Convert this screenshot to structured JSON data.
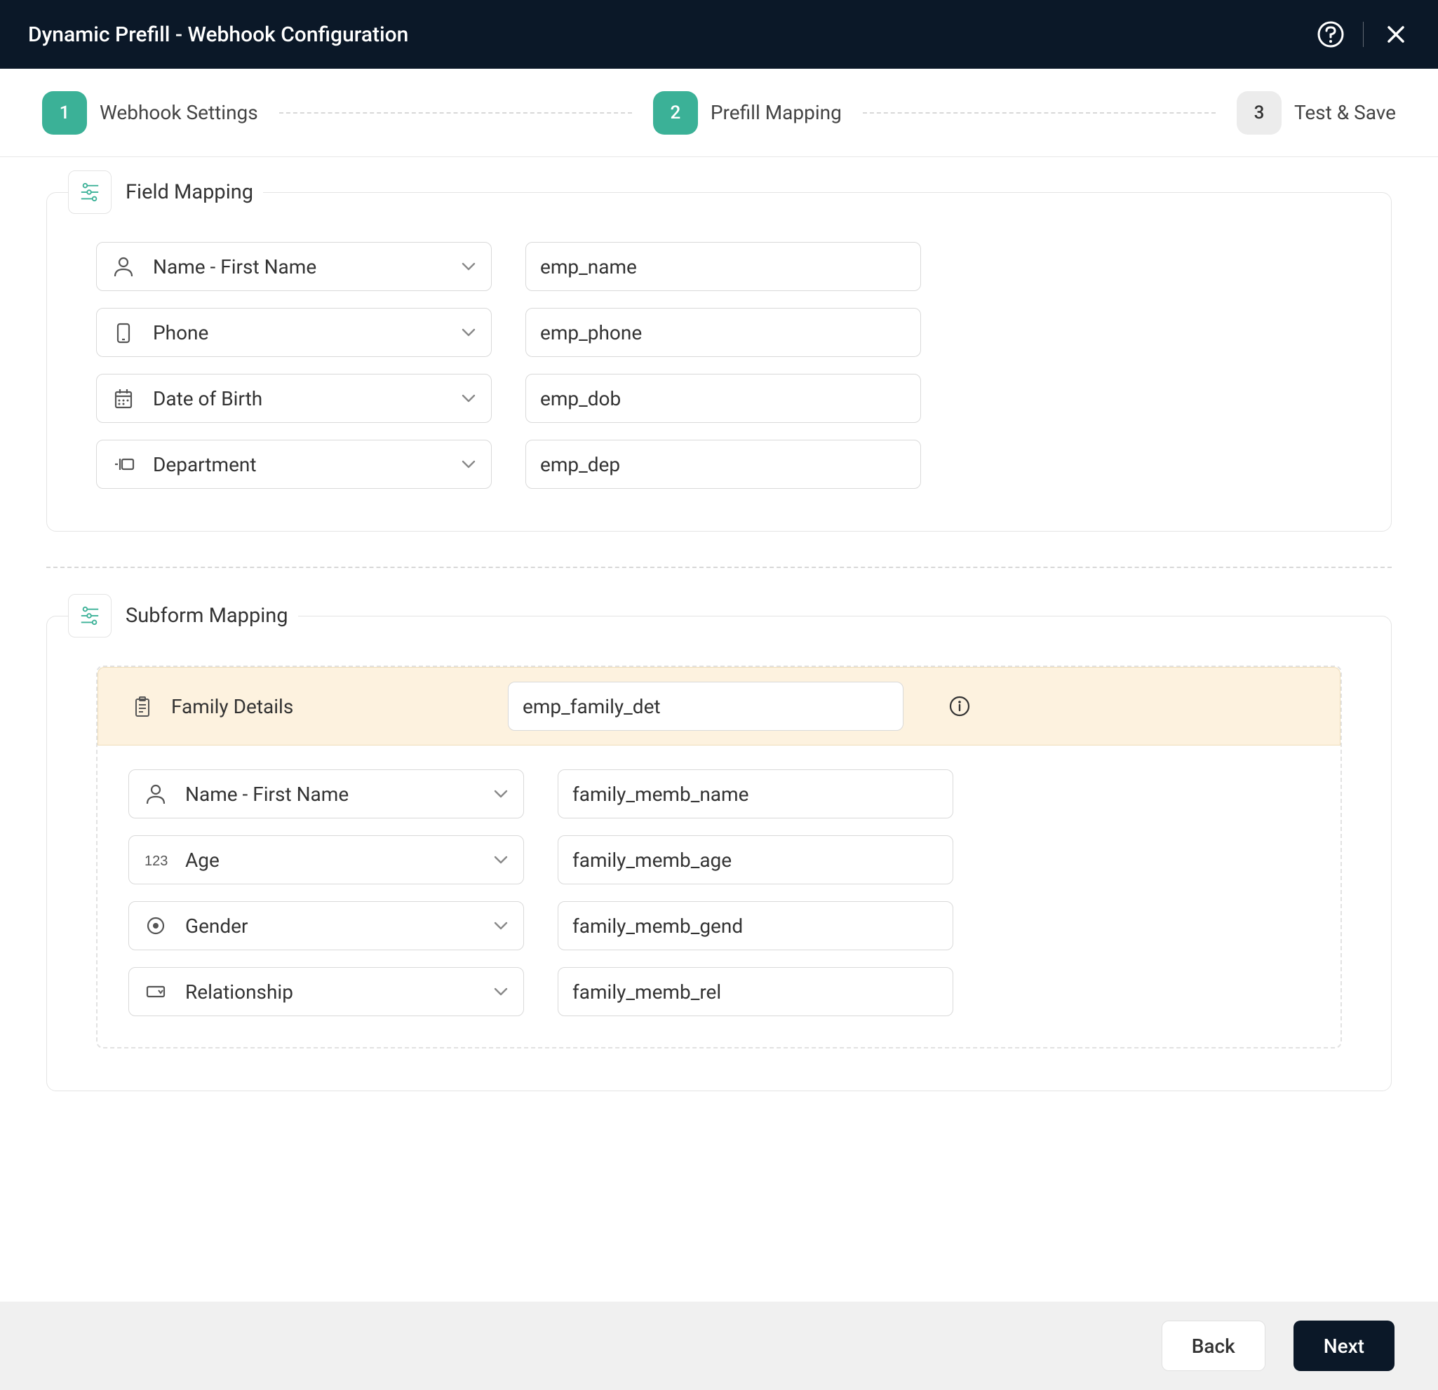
{
  "header": {
    "title": "Dynamic Prefill - Webhook Configuration"
  },
  "stepper": {
    "steps": [
      {
        "num": "1",
        "label": "Webhook Settings",
        "state": "done"
      },
      {
        "num": "2",
        "label": "Prefill Mapping",
        "state": "current"
      },
      {
        "num": "3",
        "label": "Test & Save",
        "state": "pending"
      }
    ]
  },
  "field_mapping": {
    "title": "Field Mapping",
    "rows": [
      {
        "icon": "person",
        "label": "Name - First Name",
        "value": "emp_name"
      },
      {
        "icon": "phone",
        "label": "Phone",
        "value": "emp_phone"
      },
      {
        "icon": "calendar",
        "label": "Date of Birth",
        "value": "emp_dob"
      },
      {
        "icon": "text",
        "label": "Department",
        "value": "emp_dep"
      }
    ]
  },
  "subform_mapping": {
    "title": "Subform Mapping",
    "subform": {
      "icon": "clipboard",
      "label": "Family Details",
      "value": "emp_family_det"
    },
    "rows": [
      {
        "icon": "person",
        "label": "Name - First Name",
        "value": "family_memb_name"
      },
      {
        "icon": "number",
        "label": "Age",
        "value": "family_memb_age"
      },
      {
        "icon": "radio",
        "label": "Gender",
        "value": "family_memb_gend"
      },
      {
        "icon": "dropdown",
        "label": "Relationship",
        "value": "family_memb_rel"
      }
    ]
  },
  "footer": {
    "back": "Back",
    "next": "Next"
  }
}
